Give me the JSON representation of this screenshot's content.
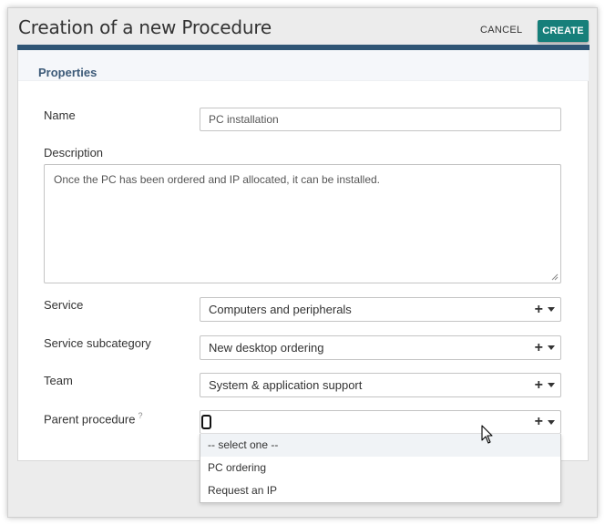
{
  "header": {
    "title": "Creation of a new Procedure",
    "cancel_label": "CANCEL",
    "create_label": "CREATE"
  },
  "panel": {
    "title": "Properties"
  },
  "form": {
    "name": {
      "label": "Name",
      "value": "PC installation"
    },
    "description": {
      "label": "Description",
      "value": "Once the PC has been ordered and IP allocated, it can be installed."
    },
    "service": {
      "label": "Service",
      "value": "Computers and peripherals"
    },
    "service_subcategory": {
      "label": "Service subcategory",
      "value": "New desktop ordering"
    },
    "team": {
      "label": "Team",
      "value": "System & application support"
    },
    "parent_procedure": {
      "label": "Parent procedure",
      "help_mark": "?",
      "value": "",
      "options": [
        "-- select one --",
        "PC ordering",
        "Request an IP"
      ]
    }
  },
  "icons": {
    "add": "plus-icon",
    "expand": "caret-down-icon",
    "help": "question-mark-icon"
  },
  "colors": {
    "accent": "#167f7a",
    "panel_bar": "#2f5575",
    "panel_title": "#3c5a78"
  }
}
